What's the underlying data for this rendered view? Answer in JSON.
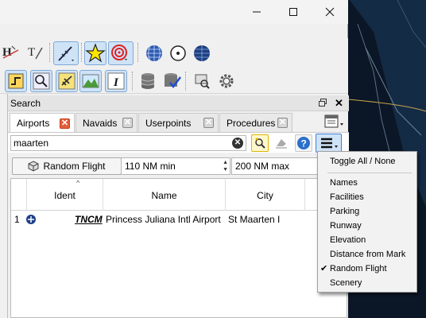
{
  "window": {
    "minimize_icon": "minimize-icon",
    "maximize_icon": "maximize-icon",
    "close_icon": "close-icon"
  },
  "dock": {
    "title": "Search",
    "float_icon": "float-window-icon",
    "close_label": "✕"
  },
  "tabs": [
    {
      "label": "Airports",
      "active": true
    },
    {
      "label": "Navaids",
      "active": false
    },
    {
      "label": "Userpoints",
      "active": false
    },
    {
      "label": "Procedures",
      "active": false
    }
  ],
  "tab_close_label": "✕",
  "search": {
    "value": "maarten",
    "clear_label": "✕"
  },
  "options": {
    "random_flight_label": "Random Flight",
    "min_distance": "110 NM min",
    "max_distance": "200 NM max",
    "spin_up": "▲",
    "spin_down": "▼"
  },
  "table": {
    "sort_indicator": "^",
    "columns": [
      "Ident",
      "Name",
      "City"
    ],
    "rows": [
      {
        "num": "1",
        "ident": "TNCM",
        "name": "Princess Juliana Intl Airport",
        "city": "St Maarten I"
      }
    ]
  },
  "popup_menu": {
    "items": [
      {
        "label": "Toggle All / None",
        "checked": false
      },
      {
        "label": "Names",
        "checked": false
      },
      {
        "label": "Facilities",
        "checked": false
      },
      {
        "label": "Parking",
        "checked": false
      },
      {
        "label": "Runway",
        "checked": false
      },
      {
        "label": "Elevation",
        "checked": false
      },
      {
        "label": "Distance from Mark",
        "checked": false
      },
      {
        "label": "Random Flight",
        "checked": true
      },
      {
        "label": "Scenery",
        "checked": false
      }
    ],
    "check_glyph": "✔"
  },
  "colors": {
    "accent": "#3d7fd6",
    "tab_close_active": "#e35d3a",
    "map_bg": "#0a1624"
  }
}
